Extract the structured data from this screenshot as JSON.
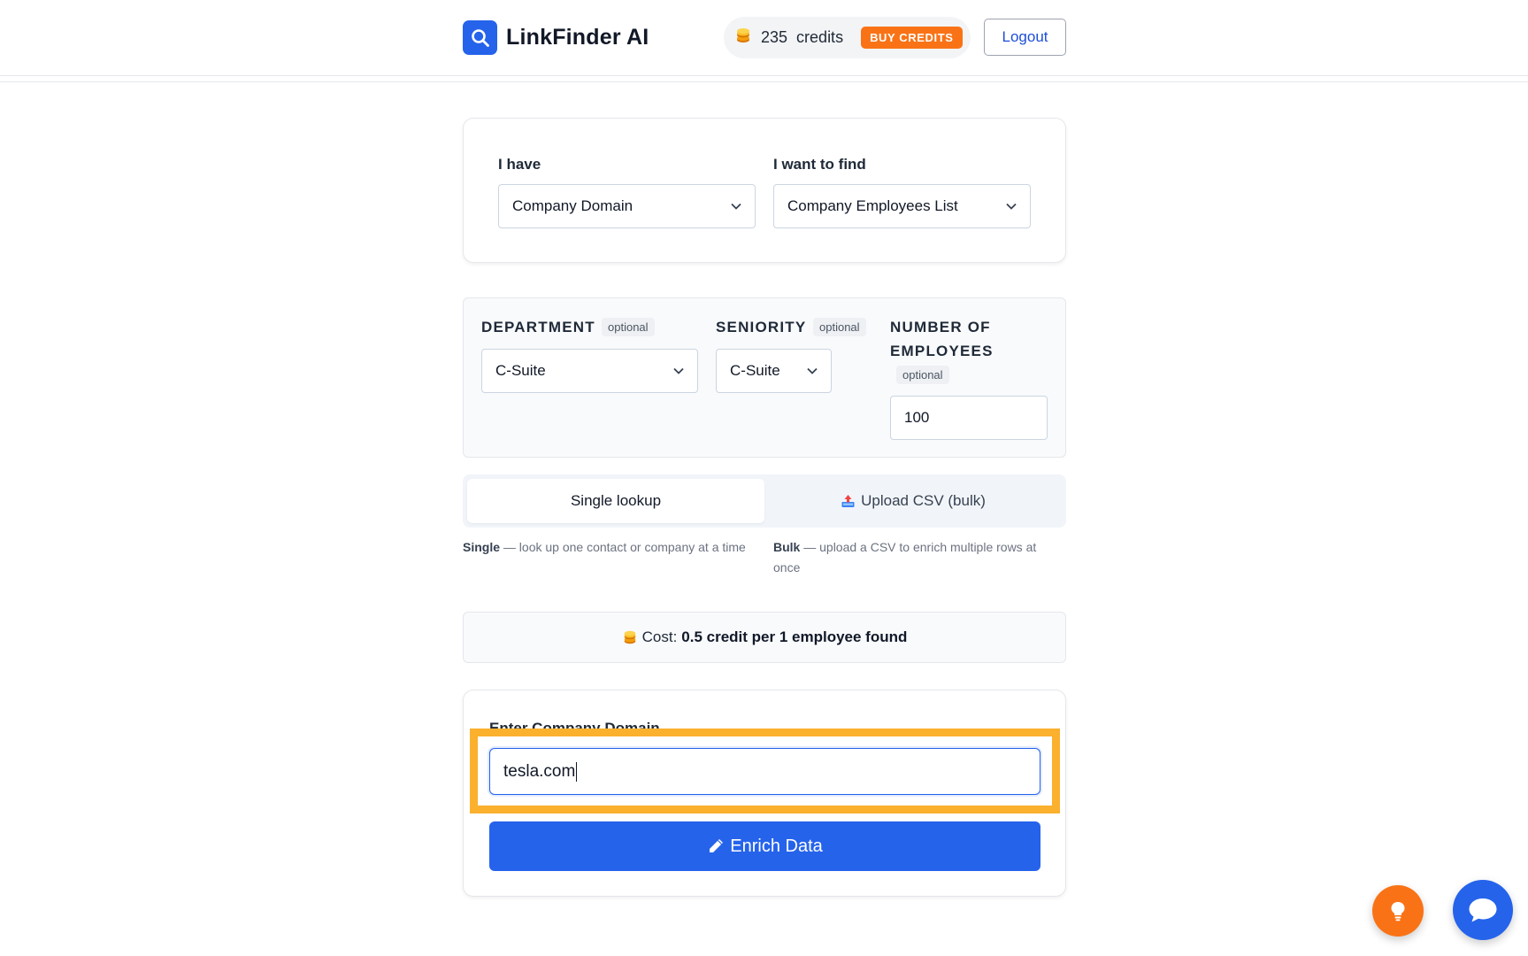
{
  "header": {
    "brand_name": "LinkFinder AI",
    "credits_count": "235",
    "credits_word": "credits",
    "buy_credits_label": "BUY CREDITS",
    "logout_label": "Logout"
  },
  "source_target": {
    "have_label": "I have",
    "have_value": "Company Domain",
    "find_label": "I want to find",
    "find_value": "Company Employees List"
  },
  "filters": {
    "department_label": "DEPARTMENT",
    "department_value": "C-Suite",
    "seniority_label": "SENIORITY",
    "seniority_value": "C-Suite",
    "employees_label_line1": "NUMBER OF",
    "employees_label_line2": "EMPLOYEES",
    "employees_value": "100",
    "optional_label": "optional"
  },
  "mode": {
    "single_label": "Single lookup",
    "bulk_label": "Upload CSV (bulk)",
    "single_desc_strong": "Single",
    "single_desc_text": " — look up one contact or company at a time",
    "bulk_desc_strong": "Bulk",
    "bulk_desc_text": " — upload a CSV to enrich multiple rows at once"
  },
  "cost": {
    "prefix": "Cost:",
    "value": "0.5 credit per 1 employee found"
  },
  "lookup": {
    "input_label": "Enter Company Domain",
    "input_value": "tesla.com",
    "enrich_label": "Enrich Data"
  },
  "colors": {
    "primary": "#2563eb",
    "accent": "#f97316",
    "highlight": "#fbb02e"
  },
  "icons": {
    "brand": "search-icon",
    "credits": "coins-icon",
    "chevron": "chevron-down-icon",
    "upload": "upload-tray-icon",
    "enrich": "pencil-icon",
    "idea": "lightbulb-icon",
    "chat": "chat-bubble-icon"
  }
}
